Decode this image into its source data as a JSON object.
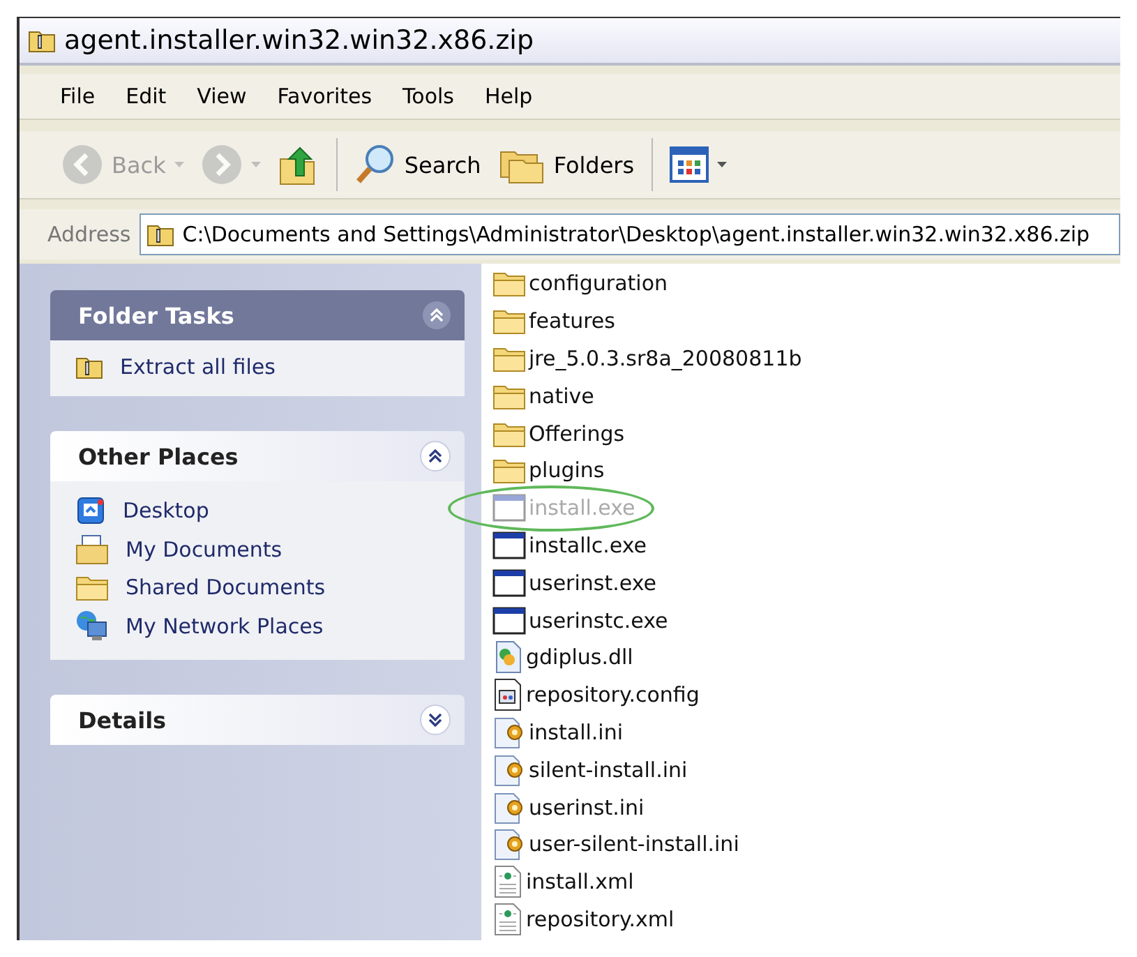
{
  "window": {
    "title": "agent.installer.win32.win32.x86.zip"
  },
  "menu": [
    "File",
    "Edit",
    "View",
    "Favorites",
    "Tools",
    "Help"
  ],
  "toolbar": [
    {
      "kind": "back",
      "label": "Back",
      "disabled": true,
      "dropdown": true
    },
    {
      "kind": "forward",
      "disabled": true,
      "dropdown": true
    },
    {
      "kind": "up",
      "disabled": false
    },
    {
      "kind": "search",
      "label": "Search",
      "disabled": false
    },
    {
      "kind": "folders",
      "label": "Folders",
      "disabled": false
    },
    {
      "kind": "views",
      "disabled": false,
      "dropdown": true
    }
  ],
  "address": {
    "label": "Address",
    "value": "C:\\Documents and Settings\\Administrator\\Desktop\\agent.installer.win32.win32.x86.zip"
  },
  "sidebar": [
    {
      "title": "Folder Tasks",
      "kind": "special",
      "expanded": true,
      "items": [
        {
          "label": "Extract all files",
          "kind": "zip"
        }
      ]
    },
    {
      "title": "Other Places",
      "kind": "normal",
      "expanded": true,
      "items": [
        {
          "label": "Desktop",
          "kind": "desktop"
        },
        {
          "label": "My Documents",
          "kind": "documents"
        },
        {
          "label": "Shared Documents",
          "kind": "folder"
        },
        {
          "label": "My Network Places",
          "kind": "network"
        }
      ]
    },
    {
      "title": "Details",
      "kind": "normal",
      "expanded": false
    }
  ],
  "files": [
    {
      "name": "configuration",
      "kind": "folder",
      "dimmed": false,
      "circled": false
    },
    {
      "name": "features",
      "kind": "folder",
      "dimmed": false,
      "circled": false
    },
    {
      "name": "jre_5.0.3.sr8a_20080811b",
      "kind": "folder",
      "dimmed": false,
      "circled": false
    },
    {
      "name": "native",
      "kind": "folder",
      "dimmed": false,
      "circled": false
    },
    {
      "name": "Offerings",
      "kind": "folder",
      "dimmed": false,
      "circled": false
    },
    {
      "name": "plugins",
      "kind": "folder",
      "dimmed": false,
      "circled": false
    },
    {
      "name": "install.exe",
      "kind": "exe",
      "dimmed": true,
      "circled": true
    },
    {
      "name": "installc.exe",
      "kind": "exe",
      "dimmed": false,
      "circled": false
    },
    {
      "name": "userinst.exe",
      "kind": "exe",
      "dimmed": false,
      "circled": false
    },
    {
      "name": "userinstc.exe",
      "kind": "exe",
      "dimmed": false,
      "circled": false
    },
    {
      "name": "gdiplus.dll",
      "kind": "dll",
      "dimmed": false,
      "circled": false
    },
    {
      "name": "repository.config",
      "kind": "config",
      "dimmed": false,
      "circled": false
    },
    {
      "name": "install.ini",
      "kind": "ini",
      "dimmed": false,
      "circled": false
    },
    {
      "name": "silent-install.ini",
      "kind": "ini",
      "dimmed": false,
      "circled": false
    },
    {
      "name": "userinst.ini",
      "kind": "ini",
      "dimmed": false,
      "circled": false
    },
    {
      "name": "user-silent-install.ini",
      "kind": "ini",
      "dimmed": false,
      "circled": false
    },
    {
      "name": "install.xml",
      "kind": "xml",
      "dimmed": false,
      "circled": false
    },
    {
      "name": "repository.xml",
      "kind": "xml",
      "dimmed": false,
      "circled": false
    }
  ]
}
